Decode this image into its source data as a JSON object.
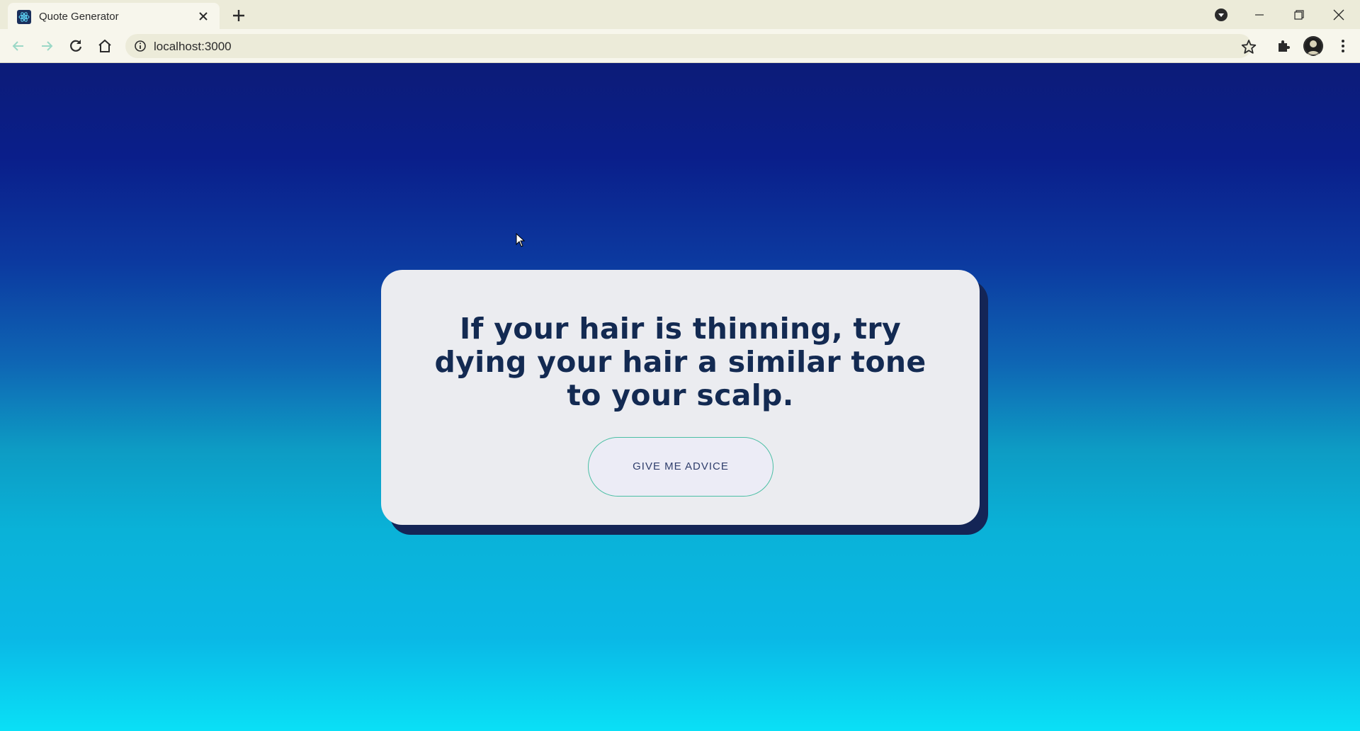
{
  "browser": {
    "tab_title": "Quote Generator",
    "url": "localhost:3000"
  },
  "icons": {
    "favicon": "react-logo-icon",
    "tab_close": "close-icon",
    "new_tab": "plus-icon",
    "media": "media-down-icon",
    "minimize": "minimize-icon",
    "restore": "restore-icon",
    "window_close": "close-icon",
    "back": "arrow-left-icon",
    "forward": "arrow-right-icon",
    "reload": "reload-icon",
    "home": "home-icon",
    "site_info": "info-icon",
    "bookmark": "star-icon",
    "extensions": "puzzle-icon",
    "profile": "avatar",
    "menu": "kebab-menu-icon"
  },
  "colors": {
    "card_bg": "#ebecf0",
    "card_shadow": "#142556",
    "quote_text": "#132a52",
    "button_border": "#4bbfa4",
    "gradient_top": "#0c1c78",
    "gradient_bottom": "#0ae0f6"
  },
  "main": {
    "quote": "If your hair is thinning, try dying your hair a similar tone to your scalp.",
    "button_label": "GIVE ME ADVICE"
  }
}
